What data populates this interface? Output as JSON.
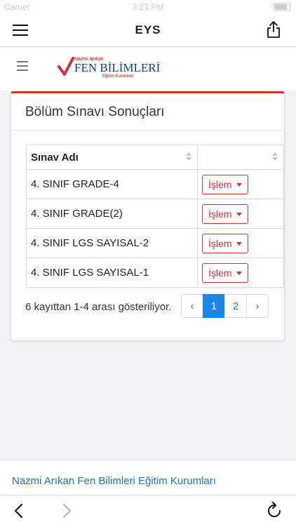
{
  "status_bar": {
    "carrier": "Carrier",
    "time": "3:23 PM"
  },
  "nav": {
    "title": "EYS"
  },
  "icons": {
    "menu": "hamburger-icon",
    "share": "share-icon",
    "back": "chevron-left-icon",
    "forward": "chevron-right-icon",
    "reload": "reload-icon"
  },
  "logo": {
    "top_text": "Nazmi Arıkan",
    "main_text": "FEN BİLİMLERİ",
    "sub_text": "Eğitim Kurumları"
  },
  "card": {
    "title": "Bölüm Sınavı Sonuçları"
  },
  "table": {
    "headers": [
      "Sınav Adı",
      ""
    ],
    "rows": [
      {
        "name": "4. SINIF GRADE-4",
        "action": "İşlem"
      },
      {
        "name": "4. SINIF GRADE(2)",
        "action": "İşlem"
      },
      {
        "name": "4. SINIF LGS SAYISAL-2",
        "action": "İşlem"
      },
      {
        "name": "4. SINIF LGS SAYISAL-1",
        "action": "İşlem"
      }
    ]
  },
  "pagination": {
    "info": "6 kayıttan 1-4 arası gösteriliyor.",
    "prev": "‹",
    "pages": [
      "1",
      "2"
    ],
    "next": "›",
    "active_page": "1"
  },
  "footer": {
    "link": "Nazmi Arıkan Fen Bilimleri Eğitim Kurumları"
  },
  "colors": {
    "accent": "#d0303a",
    "link": "#1b73c4",
    "active_page": "#1a86e8",
    "brand_blue": "#123f8a"
  }
}
